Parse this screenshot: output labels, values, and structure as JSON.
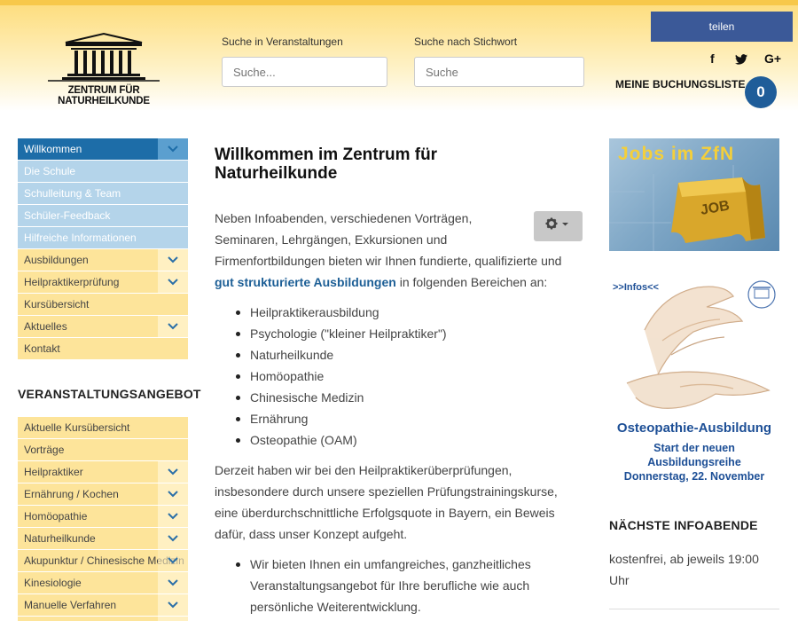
{
  "header": {
    "logo_text": "ZENTRUM FÜR NATURHEILKUNDE",
    "search_events_label": "Suche in Veranstaltungen",
    "search_events_placeholder": "Suche...",
    "search_keyword_label": "Suche nach Stichwort",
    "search_keyword_placeholder": "Suche",
    "share_label": "teilen",
    "social_icons": [
      "facebook-icon",
      "twitter-icon",
      "google-plus-icon"
    ],
    "facebook_glyph": "f",
    "google_plus_glyph": "G+",
    "booking_label": "MEINE BUCHUNGSLISTE",
    "booking_count": "0"
  },
  "sidebar": {
    "menu": [
      {
        "label": "Willkommen",
        "style": "active",
        "has_children": true
      },
      {
        "label": "Die Schule",
        "style": "blue",
        "has_children": false
      },
      {
        "label": "Schulleitung & Team",
        "style": "blue",
        "has_children": false
      },
      {
        "label": "Schüler-Feedback",
        "style": "blue",
        "has_children": false
      },
      {
        "label": "Hilfreiche Informationen",
        "style": "blue",
        "has_children": false
      },
      {
        "label": "Ausbildungen",
        "style": "yellow",
        "has_children": true
      },
      {
        "label": "Heilpraktikerprüfung",
        "style": "yellow",
        "has_children": true
      },
      {
        "label": "Kursübersicht",
        "style": "yellow",
        "has_children": false
      },
      {
        "label": "Aktuelles",
        "style": "yellow",
        "has_children": true
      },
      {
        "label": "Kontakt",
        "style": "yellow",
        "has_children": false
      }
    ],
    "events_heading": "VERANSTALTUNGSANGEBOT",
    "events": [
      {
        "label": "Aktuelle Kursübersicht",
        "has_children": false
      },
      {
        "label": "Vorträge",
        "has_children": false
      },
      {
        "label": "Heilpraktiker",
        "has_children": true
      },
      {
        "label": "Ernährung / Kochen",
        "has_children": true
      },
      {
        "label": "Homöopathie",
        "has_children": true
      },
      {
        "label": "Naturheilkunde",
        "has_children": true
      },
      {
        "label": "Akupunktur / Chinesische Medizin",
        "has_children": true
      },
      {
        "label": "Kinesiologie",
        "has_children": true
      },
      {
        "label": "Manuelle Verfahren",
        "has_children": true
      }
    ]
  },
  "main": {
    "title": "Willkommen im Zentrum für Naturheilkunde",
    "intro_line1": "Neben Infoabenden, verschiedenen Vorträgen,",
    "intro_line2": "Seminaren, Lehrgängen, Exkursionen und",
    "intro_line3": "Firmenfortbildungen bieten wir Ihnen fundierte, qualifizierte und",
    "intro_link": "gut strukturierte Ausbildungen",
    "intro_tail": " in folgenden Bereichen an:",
    "areas": [
      "Heilpraktikerausbildung",
      "Psychologie (\"kleiner Heilpraktiker\")",
      "Naturheilkunde",
      "Homöopathie",
      "Chinesische Medizin",
      "Ernährung",
      "Osteopathie (OAM)"
    ],
    "para2_line1": "Derzeit haben wir bei den Heilpraktikerüberprüfungen,",
    "para2_line2": "insbesondere durch unsere speziellen Prüfungstrainingskurse,",
    "para2_line3": "eine überdurchschnittliche Erfolgsquote in Bayern, ein Beweis",
    "para2_line4": "dafür, dass unser Konzept aufgeht.",
    "offer_line1": "Wir bieten Ihnen ein umfangreiches, ganzheitliches",
    "offer_line2": "Veranstaltungsangebot für Ihre berufliche wie auch",
    "offer_line3": "persönliche Weiterentwicklung."
  },
  "right": {
    "jobs_banner_text": "Jobs im ZfN",
    "jobs_puzzle_text": "JOB",
    "infos_label": ">>Infos<<",
    "osteo_title": "Osteopathie-Ausbildung",
    "osteo_line1": "Start der neuen",
    "osteo_line2": "Ausbildungsreihe",
    "osteo_line3": "Donnerstag, 22. November",
    "next_heading": "NÄCHSTE INFOABENDE",
    "next_text_line1": "kostenfrei, ab jeweils 19:00",
    "next_text_line2": "Uhr"
  },
  "colors": {
    "active": "#1d6da8",
    "submenu_blue": "#b4d4ea",
    "submenu_yellow": "#fde49a",
    "share": "#3b5998",
    "booking_badge": "#1f5d99",
    "link": "#1d5f96"
  }
}
